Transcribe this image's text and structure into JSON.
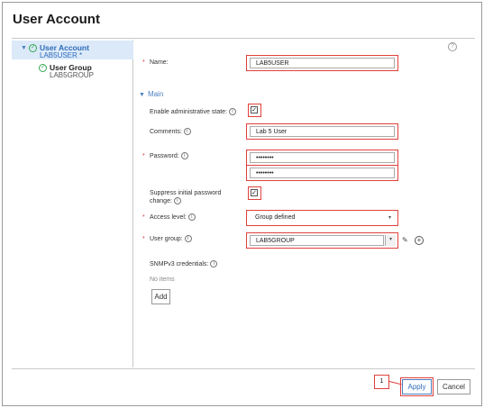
{
  "page": {
    "title": "User Account"
  },
  "tree": {
    "items": [
      {
        "label": "User Account",
        "sub": "LAB5USER *"
      },
      {
        "label": "User Group",
        "sub": "LAB5GROUP"
      }
    ]
  },
  "form": {
    "name": {
      "label": "Name:",
      "value": "LAB5USER"
    },
    "section": {
      "label": "Main"
    },
    "admin_state": {
      "label": "Enable administrative state:",
      "checked": true
    },
    "comments": {
      "label": "Comments:",
      "value": "Lab 5 User"
    },
    "password": {
      "label": "Password:",
      "value": "••••••••",
      "confirm": "••••••••"
    },
    "suppress": {
      "label_line1": "Suppress initial password",
      "label_line2": "change:",
      "checked": true
    },
    "access_level": {
      "label": "Access level:",
      "value": "Group defined"
    },
    "user_group": {
      "label": "User group:",
      "value": "LAB5GROUP"
    },
    "snmp": {
      "label": "SNMPv3 credentials:",
      "empty_text": "No items"
    },
    "add_label": "Add"
  },
  "footer": {
    "callout": "1",
    "apply": "Apply",
    "cancel": "Cancel"
  },
  "icons": {
    "help": "?",
    "info": "i",
    "check": "✓",
    "caret_down": "▼",
    "select_arrow": "▾",
    "edit": "✎",
    "plus": "+"
  },
  "colors": {
    "highlight": "#e0413c",
    "link_blue": "#4a7fc1",
    "selection": "#dbe9f9",
    "success": "#34a853"
  }
}
